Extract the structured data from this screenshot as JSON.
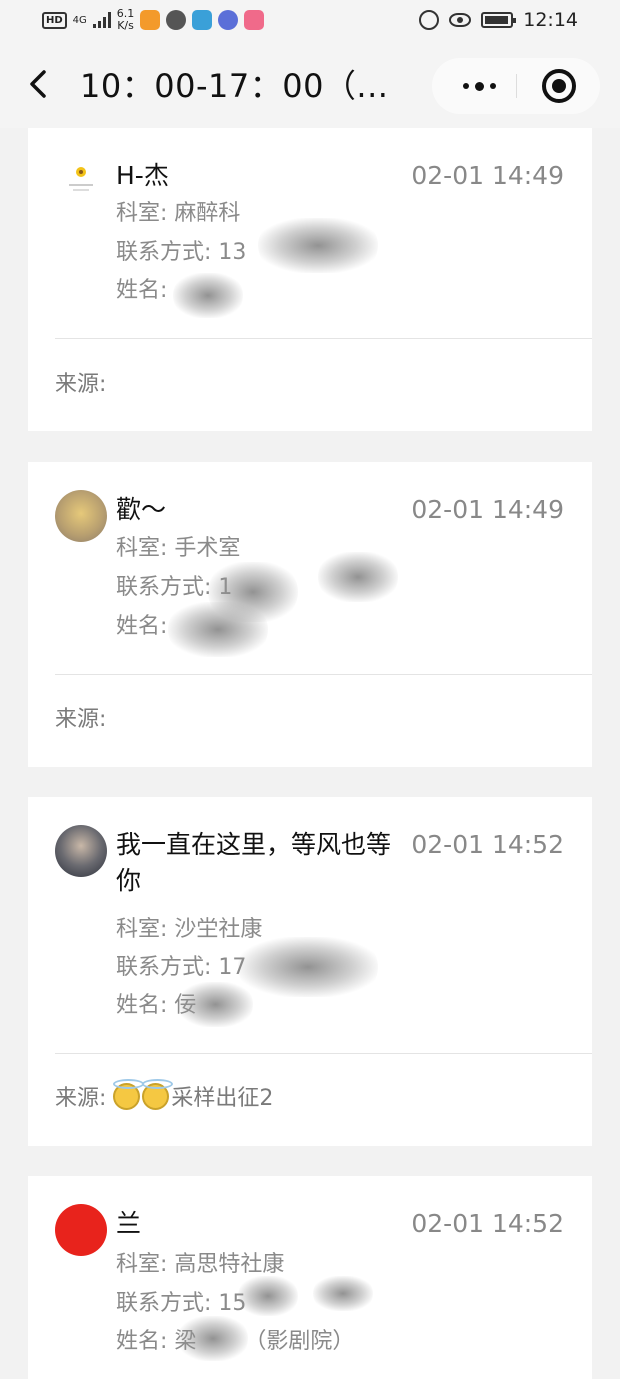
{
  "status_bar": {
    "network": "HD",
    "signal": "4G",
    "speed_value": "6.1",
    "speed_unit": "K/s",
    "clock": "12:14"
  },
  "nav": {
    "title": "10：00-17：00（..."
  },
  "cards": [
    {
      "name": "H-杰",
      "time": "02-01 14:49",
      "department": "科室: 麻醉科",
      "contact": "联系方式: 13",
      "fullname": "姓名: ",
      "source": "来源: "
    },
    {
      "name": "歡～",
      "time": "02-01 14:49",
      "department": "科室: 手术室",
      "contact": "联系方式: 1",
      "fullname": "姓名: ",
      "source": "来源: "
    },
    {
      "name": "我一直在这里，等风也等",
      "name_line2": "你",
      "time": "02-01 14:52",
      "department": "科室: 沙坣社康",
      "contact": "联系方式: 17",
      "fullname": "姓名: 佞",
      "source": "来源: ",
      "source_text": "采样出征2"
    },
    {
      "name": "兰",
      "time": "02-01 14:52",
      "department": "科室: 高思特社康",
      "contact": "联系方式: 15",
      "fullname": "姓名: 梁",
      "fullname_suffix": "（影剧院）"
    }
  ]
}
